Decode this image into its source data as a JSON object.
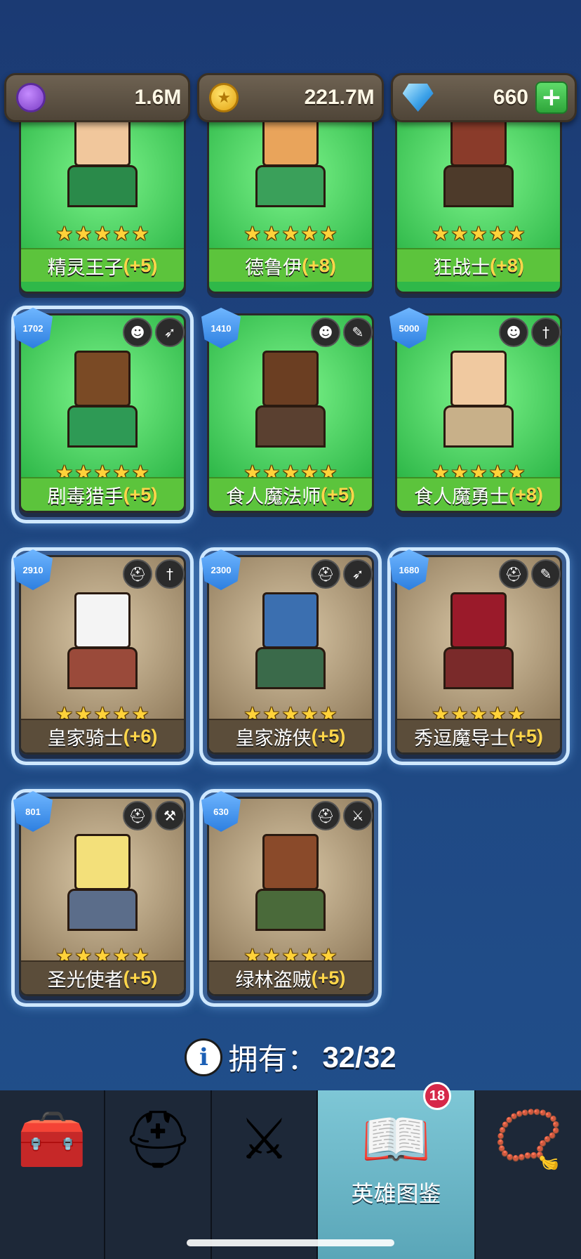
{
  "currency": {
    "purple": "1.6M",
    "gold": "221.7M",
    "gems": "660",
    "plus": "+"
  },
  "heroes": [
    {
      "name": "精灵王子",
      "bonus": "(+5)",
      "level": "",
      "theme": "green"
    },
    {
      "name": "德鲁伊",
      "bonus": "(+8)",
      "level": "",
      "theme": "green"
    },
    {
      "name": "狂战士",
      "bonus": "(+8)",
      "level": "",
      "theme": "green"
    },
    {
      "name": "剧毒猎手",
      "bonus": "(+5)",
      "level": "1702",
      "theme": "green"
    },
    {
      "name": "食人魔法师",
      "bonus": "(+5)",
      "level": "1410",
      "theme": "green"
    },
    {
      "name": "食人魔勇士",
      "bonus": "(+8)",
      "level": "5000",
      "theme": "green"
    },
    {
      "name": "皇家骑士",
      "bonus": "(+6)",
      "level": "2910",
      "theme": "brown"
    },
    {
      "name": "皇家游侠",
      "bonus": "(+5)",
      "level": "2300",
      "theme": "brown"
    },
    {
      "name": "秀逗魔导士",
      "bonus": "(+5)",
      "level": "1680",
      "theme": "brown"
    },
    {
      "name": "圣光使者",
      "bonus": "(+5)",
      "level": "801",
      "theme": "brown"
    },
    {
      "name": "绿林盗贼",
      "bonus": "(+5)",
      "level": "630",
      "theme": "brown"
    }
  ],
  "stars": "★",
  "owned": {
    "info": "i",
    "label": "拥有：",
    "count": "32/32"
  },
  "nav": {
    "chest": "🧰",
    "helmet": "⛑",
    "battle": "⚔",
    "book": "📖",
    "book_label": "英雄图鉴",
    "book_badge": "18",
    "amulet": "📿"
  }
}
